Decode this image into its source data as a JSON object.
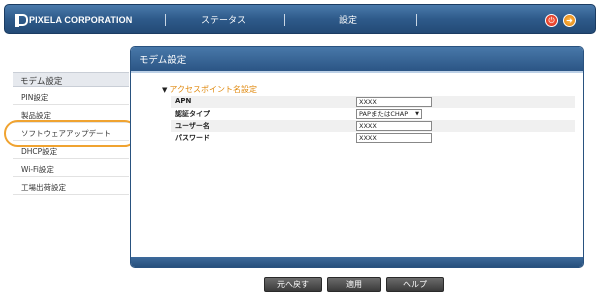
{
  "header": {
    "logo_text": "PIXELA CORPORATION",
    "nav": [
      {
        "label": "ステータス"
      },
      {
        "label": "設定"
      }
    ],
    "power_icon": "power-icon",
    "logout_icon": "logout-icon"
  },
  "sidebar": {
    "section_title": "モデム設定",
    "items": [
      {
        "label": "PIN設定"
      },
      {
        "label": "製品設定"
      },
      {
        "label": "ソフトウェアアップデート"
      },
      {
        "label": "DHCP設定"
      },
      {
        "label": "Wi-Fi設定"
      },
      {
        "label": "工場出荷設定"
      }
    ],
    "highlight_color": "#f0a330"
  },
  "panel": {
    "title": "モデム設定",
    "section_title": "アクセスポイント名設定",
    "fields": [
      {
        "label": "APN",
        "value": "XXXX"
      },
      {
        "label": "認証タイプ",
        "value": "PAPまたはCHAP"
      },
      {
        "label": "ユーザー名",
        "value": "XXXX"
      },
      {
        "label": "パスワード",
        "value": "XXXX"
      }
    ]
  },
  "buttons": {
    "back": "元へ戻す",
    "apply": "適用",
    "help": "ヘルプ"
  },
  "colors": {
    "header_blue": "#2e5a8a",
    "section_orange": "#e08a10"
  }
}
